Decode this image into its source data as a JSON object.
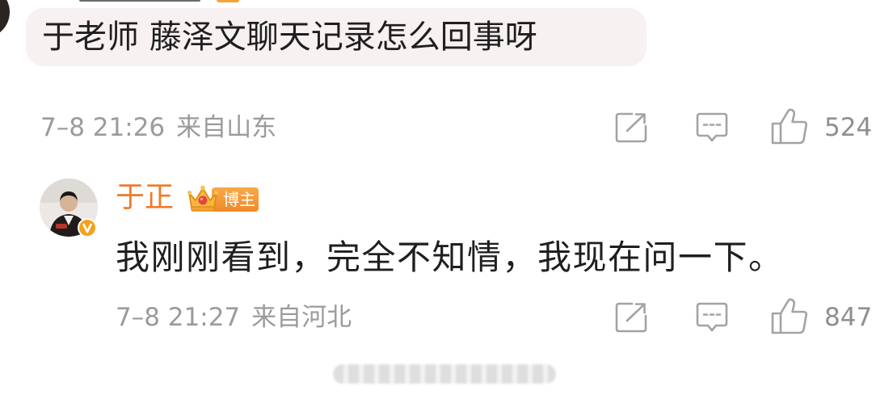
{
  "page": {
    "background": "#ffffff"
  },
  "comment": {
    "text": "于老师 藤泽文聊天记录怎么回事呀",
    "time": "7–8 21:26",
    "location": "来自山东",
    "likes": "524"
  },
  "reply": {
    "username": "于正",
    "badge_label": "博主",
    "text": "我刚刚看到，完全不知情，我现在问一下。",
    "time": "7–8 21:27",
    "location": "来自河北",
    "likes": "847"
  },
  "icons": {
    "share": "share-icon",
    "comment": "comment-icon",
    "like": "like-icon",
    "verified": "verified-badge-icon",
    "crown": "crown-icon"
  },
  "colors": {
    "username": "#ee7a2a",
    "meta_text": "#9b9b9b",
    "bubble_bg": "#f7f1f1",
    "badge_bg": "#f49a3a",
    "body_text": "#1f1f1f"
  }
}
